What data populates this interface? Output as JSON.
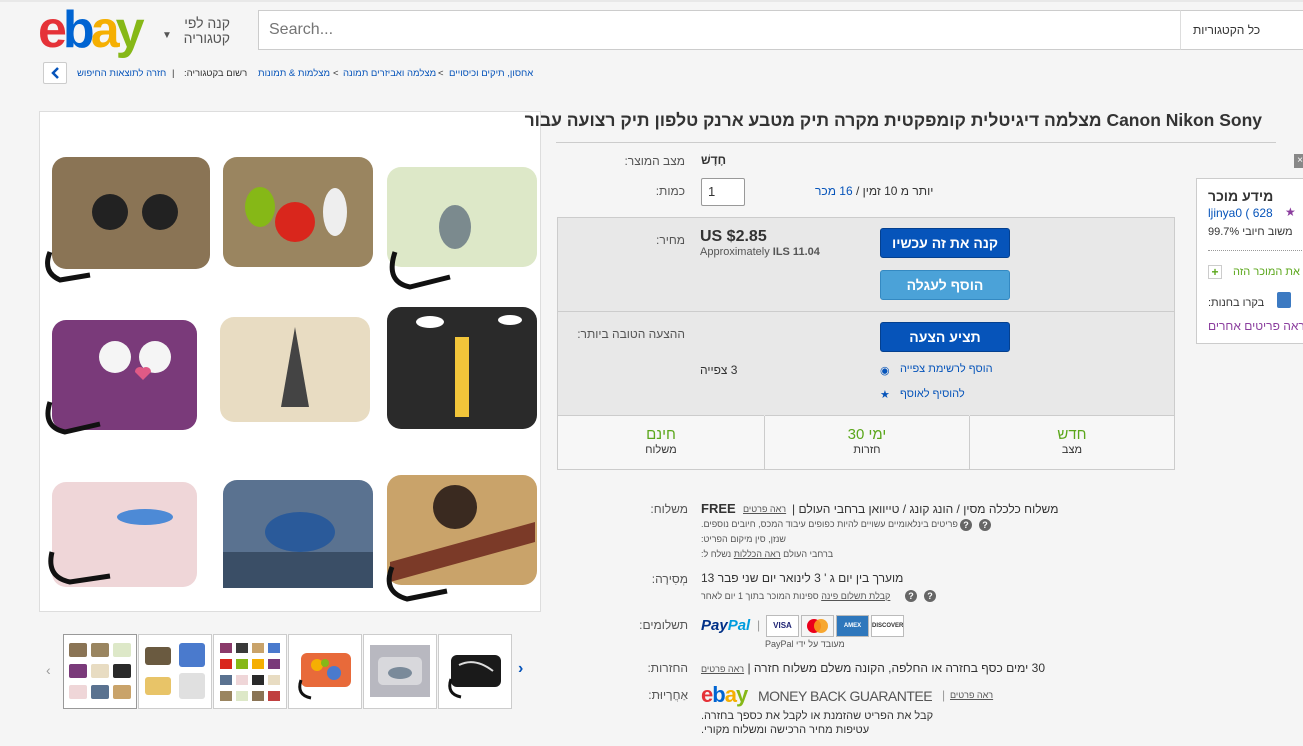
{
  "header": {
    "logo": {
      "e": "e",
      "b": "b",
      "a": "a",
      "y": "y"
    },
    "shop_by_category": "קנה לפי קטגוריה",
    "search_placeholder": "Search...",
    "category_select": "כל הקטגוריות"
  },
  "breadcrumb": {
    "back_label": "חזרה לתוצאות החיפוש",
    "listed_in": "רשום בקטגוריה:",
    "crumbs": [
      "מצלמות & תמונות",
      "מצלמה ואביזרים תמונה",
      "אחסון, תיקים וכיסויים"
    ],
    "separator": ">"
  },
  "listing": {
    "title": "Canon Nikon Sony מצלמה דיגיטלית קומפקטית מקרה תיק מטבע ארנק טלפון תיק רצועה עבור",
    "condition_label": "מצב המוצר:",
    "condition_value": "חָדָשׁ",
    "quantity_label": "כמות:",
    "quantity_value": "1",
    "availability": "יותר מ 10 זמין / ",
    "sold_link": "16 מכר",
    "price_label": "מחיר:",
    "price": "US $2.85",
    "approx_prefix": "Approximately",
    "approx_value": "ILS 11.04",
    "buy_now": "קנה את זה עכשיו",
    "add_to_cart": "הוסף לעגלה",
    "best_offer_label": "ההצעה הטובה ביותר:",
    "make_offer": "תציע הצעה",
    "watchers": "3 צפייה",
    "add_watch": "הוסף לרשימת צפייה",
    "add_collection": "להוסיף לאוסף",
    "features": [
      {
        "big": "חדש",
        "small": "מצב"
      },
      {
        "big": "ימי 30",
        "small": "חזרות"
      },
      {
        "big": "חינם",
        "small": "משלוח"
      }
    ]
  },
  "seller": {
    "title": "מידע מוכר",
    "name": "ljinya0",
    "score": "( 628",
    "star": "★",
    "positive": "99.7% משוב חיובי",
    "save_seller": "שמור את המוכר הזה",
    "visit_store": "בקרו בחנות:",
    "more_items": "ראה פריטים אחרים",
    "close": "×"
  },
  "details": {
    "shipping_label": "משלוח:",
    "shipping_value": "FREE",
    "shipping_see": "ראה פרטים",
    "shipping_desc": "משלוח כלכלה מסין / הונג קונג / טייוואן ברחבי העולם |",
    "shipping_note": "פריטים בינלאומיים עשויים להיות כפופים עיבוד המכס, חיובים נוספים.",
    "location_label": "מיקום הפריט:",
    "location_value": "שנזן, סין",
    "ships_to_label": "נשלח ל:",
    "ships_to_value": "ברחבי העולם",
    "ships_to_link": "ראה הכללות",
    "delivery_label": "מְסִירָה:",
    "delivery_value": "מוערך בין יום ג ' 3 לינואר יום שני פבר 13",
    "delivery_note": "ספינות המוכר בתוך 1 יום לאחר",
    "delivery_link": "קבלת תשלום פינה",
    "payments_label": "תשלומים:",
    "paypal_a": "Pay",
    "paypal_b": "Pal",
    "cards": [
      "VISA",
      "MC",
      "AMEX",
      "DISCOVER"
    ],
    "processed_by": "מעובד על ידי PayPal",
    "returns_label": "החזרות:",
    "returns_value": "30 ימים כסף בחזרה או החלפה, הקונה משלם משלוח חזרה |",
    "returns_see": "ראה פרטים",
    "guarantee_label": "אַחֲרָיוּת:",
    "mbg_text": "MONEY BACK GUARANTEE",
    "mbg_see": "ראה פרטים",
    "mbg_line1": "קבל את הפריט שהזמנת או לקבל את כספך בחזרה.",
    "mbg_line2": "עטיפות מחיר הרכישה ומשלוח מקורי.",
    "qmark": "?"
  },
  "thumbs_nav": {
    "prev": "‹",
    "next": "›"
  }
}
